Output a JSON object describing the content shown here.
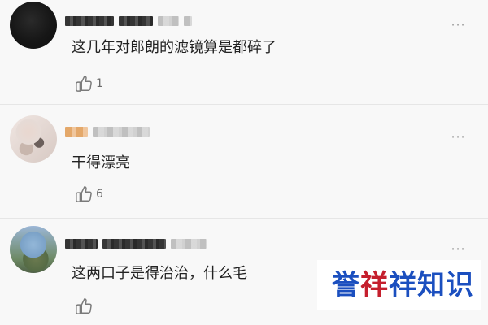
{
  "comments": [
    {
      "text": "这几年对郎朗的滤镜算是都碎了",
      "likes": "1",
      "more": "⋯"
    },
    {
      "text": "干得漂亮",
      "likes": "6",
      "more": "⋯"
    },
    {
      "text": "这两口子是得治治，什么毛",
      "likes": "",
      "more": "⋯"
    }
  ],
  "watermark": {
    "line_1": "誉",
    "line_2": "祥",
    "line_3": "祥知识"
  },
  "icons": {
    "like": "thumbs-up-icon",
    "more": "more-options-icon"
  },
  "colors": {
    "background": "#f8f8f8",
    "text_primary": "#222222",
    "text_secondary": "#6b6b6b",
    "watermark_blue": "#1b4fbf",
    "watermark_red": "#c51f2d"
  }
}
